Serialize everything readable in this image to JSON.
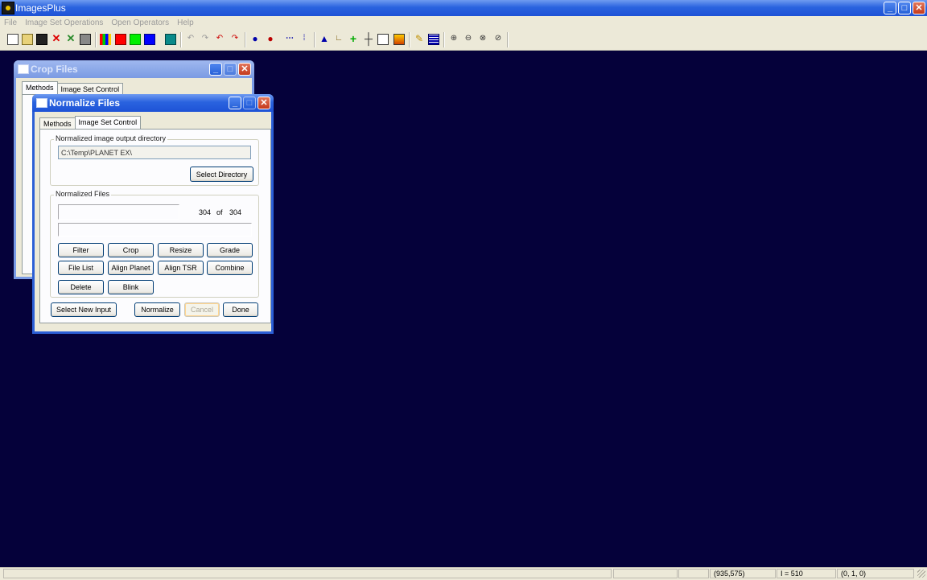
{
  "app": {
    "title": "ImagesPlus"
  },
  "menu": [
    "File",
    "Image Set Operations",
    "Open Operators",
    "Help"
  ],
  "toolbar": {
    "buttons": [
      "new-file",
      "open-file",
      "save-file",
      "close-file",
      "close-all",
      "copy-to-clipboard",
      "rgb-channels",
      "red-channel",
      "green-channel",
      "blue-channel",
      "grid-view",
      "undo",
      "redo",
      "undo-all",
      "redo-all",
      "blue-dot",
      "red-dot",
      "dotted-line",
      "point-selection",
      "blue-triangle",
      "corner-tool",
      "green-plus",
      "crosshair",
      "grid-measure",
      "picture-tool",
      "pencil-tool",
      "table-tool",
      "zoom-in",
      "zoom-out",
      "zoom-fit",
      "zoom-reset"
    ]
  },
  "windows": {
    "crop": {
      "title": "Crop Files",
      "tabs": [
        "Methods",
        "Image Set Control"
      ]
    },
    "normalize": {
      "title": "Normalize Files",
      "tabs": [
        "Methods",
        "Image Set Control"
      ],
      "output_group_label": "Normalized image output directory",
      "output_directory": "C:\\Temp\\PLANET EX\\",
      "select_directory": "Select Directory",
      "files_group_label": "Normalized Files",
      "progress": {
        "current": "304",
        "of": "of",
        "total": "304",
        "fraction": 1.0
      },
      "actions": [
        "Filter",
        "Crop",
        "Resize",
        "Grade",
        "File List",
        "Align Planet",
        "Align TSR",
        "Combine",
        "Delete",
        "Blink"
      ],
      "select_new_input": "Select New Input",
      "normalize_button": "Normalize",
      "cancel_button": "Cancel",
      "done_button": "Done"
    }
  },
  "status": {
    "coords": "(935,575)",
    "intensity": "I = 510",
    "rgb": "(0, 1, 0)"
  }
}
